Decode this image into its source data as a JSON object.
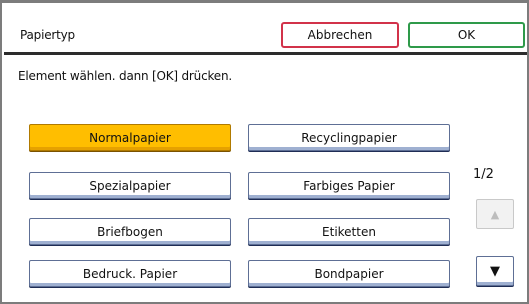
{
  "header": {
    "title": "Papiertyp",
    "cancel_label": "Abbrechen",
    "ok_label": "OK"
  },
  "instruction": "Element wählen. dann [OK] drücken.",
  "options": [
    {
      "label": "Normalpapier",
      "selected": true
    },
    {
      "label": "Recyclingpapier",
      "selected": false
    },
    {
      "label": "Spezialpapier",
      "selected": false
    },
    {
      "label": "Farbiges Papier",
      "selected": false
    },
    {
      "label": "Briefbogen",
      "selected": false
    },
    {
      "label": "Etiketten",
      "selected": false
    },
    {
      "label": "Bedruck. Papier",
      "selected": false
    },
    {
      "label": "Bondpapier",
      "selected": false
    }
  ],
  "pagination": {
    "indicator": "1/2",
    "up_icon": "up-arrow-icon",
    "down_icon": "down-arrow-icon",
    "up_glyph": "▲",
    "down_glyph": "▼",
    "up_enabled": false,
    "down_enabled": true
  },
  "colors": {
    "selected_background": "#ffbe00",
    "cancel_border": "#d2324a",
    "ok_border": "#2e9a4a",
    "button_border": "#5e6f95"
  }
}
